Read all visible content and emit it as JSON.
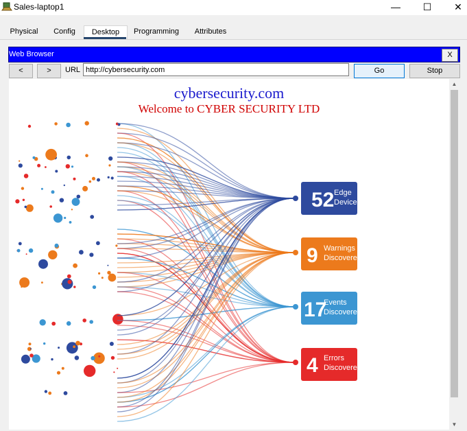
{
  "window": {
    "title": "Sales-laptop1",
    "minimize_glyph": "—",
    "maximize_glyph": "☐",
    "close_glyph": "✕"
  },
  "tabs": [
    {
      "label": "Physical"
    },
    {
      "label": "Config"
    },
    {
      "label": "Desktop"
    },
    {
      "label": "Programming"
    },
    {
      "label": "Attributes"
    }
  ],
  "active_tab": "Desktop",
  "browser": {
    "title": "Web Browser",
    "close_label": "X",
    "back_label": "<",
    "forward_label": ">",
    "url_label": "URL",
    "url_value": "http://cybersecurity.com",
    "go_label": "Go",
    "stop_label": "Stop"
  },
  "page": {
    "site_title": "cybersecurity.com",
    "site_subtitle": "Welcome to CYBER SECURITY LTD",
    "badges": [
      {
        "number": "52",
        "line1": "Edge",
        "line2": "Devices",
        "color": "#2e4a9e"
      },
      {
        "number": "9",
        "line1": "Warnings",
        "line2": "Discovered",
        "color": "#ec7a1c"
      },
      {
        "number": "17",
        "line1": "Events",
        "line2": "Discovered",
        "color": "#3c96d2"
      },
      {
        "number": "4",
        "line1": "Errors",
        "line2": "Discovered",
        "color": "#e52a2a"
      }
    ]
  },
  "colors": {
    "browser_header": "#0000ff",
    "tab_underline": "#26466d",
    "title_blue": "#1a1acd",
    "subtitle_red": "#d00000"
  },
  "icons": {
    "app": "laptop-icon",
    "scroll_up": "scroll-up-arrow-icon",
    "scroll_down": "scroll-down-arrow-icon"
  }
}
